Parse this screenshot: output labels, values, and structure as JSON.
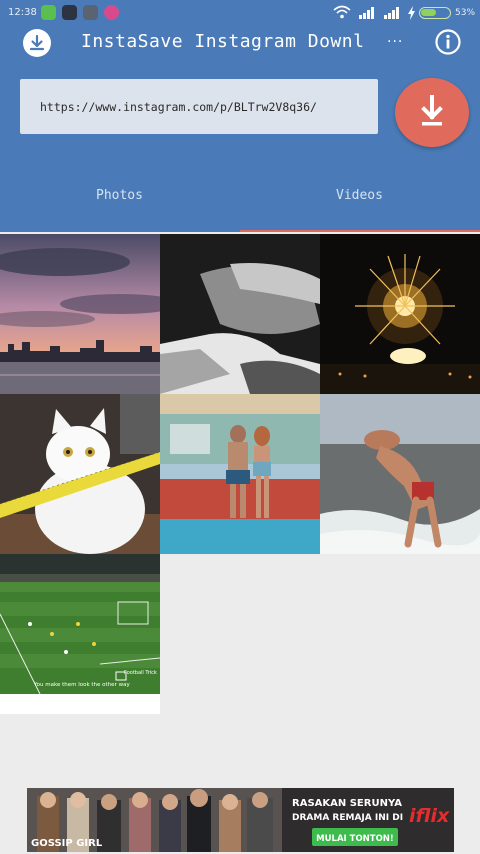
{
  "status_bar": {
    "time": "12:38",
    "battery_percent_label": "53%",
    "battery_level": 0.53
  },
  "app": {
    "title": "InstaSave Instagram Downl",
    "overflow_label": "···"
  },
  "url_input": {
    "value": "https://www.instagram.com/p/BLTrw2V8q36/"
  },
  "tabs": [
    {
      "label": "Photos",
      "selected": false
    },
    {
      "label": "Videos",
      "selected": true
    }
  ],
  "gallery": {
    "items": [
      {
        "subject": "sunset-city-skyline"
      },
      {
        "subject": "black-white-sleeping"
      },
      {
        "subject": "fireworks"
      },
      {
        "subject": "white-cat-measuring-tape"
      },
      {
        "subject": "couple-poolside"
      },
      {
        "subject": "beach-surf-man"
      },
      {
        "subject": "soccer-match",
        "caption": "You make them look the other way",
        "watermark": "Football Trick"
      }
    ]
  },
  "ad": {
    "logo_text": "GOSSIP GIRL",
    "tagline_line1": "RASAKAN SERUNYA",
    "tagline_line2": "DRAMA REMAJA INI DI",
    "brand": "iflix",
    "cta": "MULAI TONTON!"
  },
  "colors": {
    "primary": "#4a7bb8",
    "accent": "#e06a5c",
    "background": "#ececec"
  }
}
